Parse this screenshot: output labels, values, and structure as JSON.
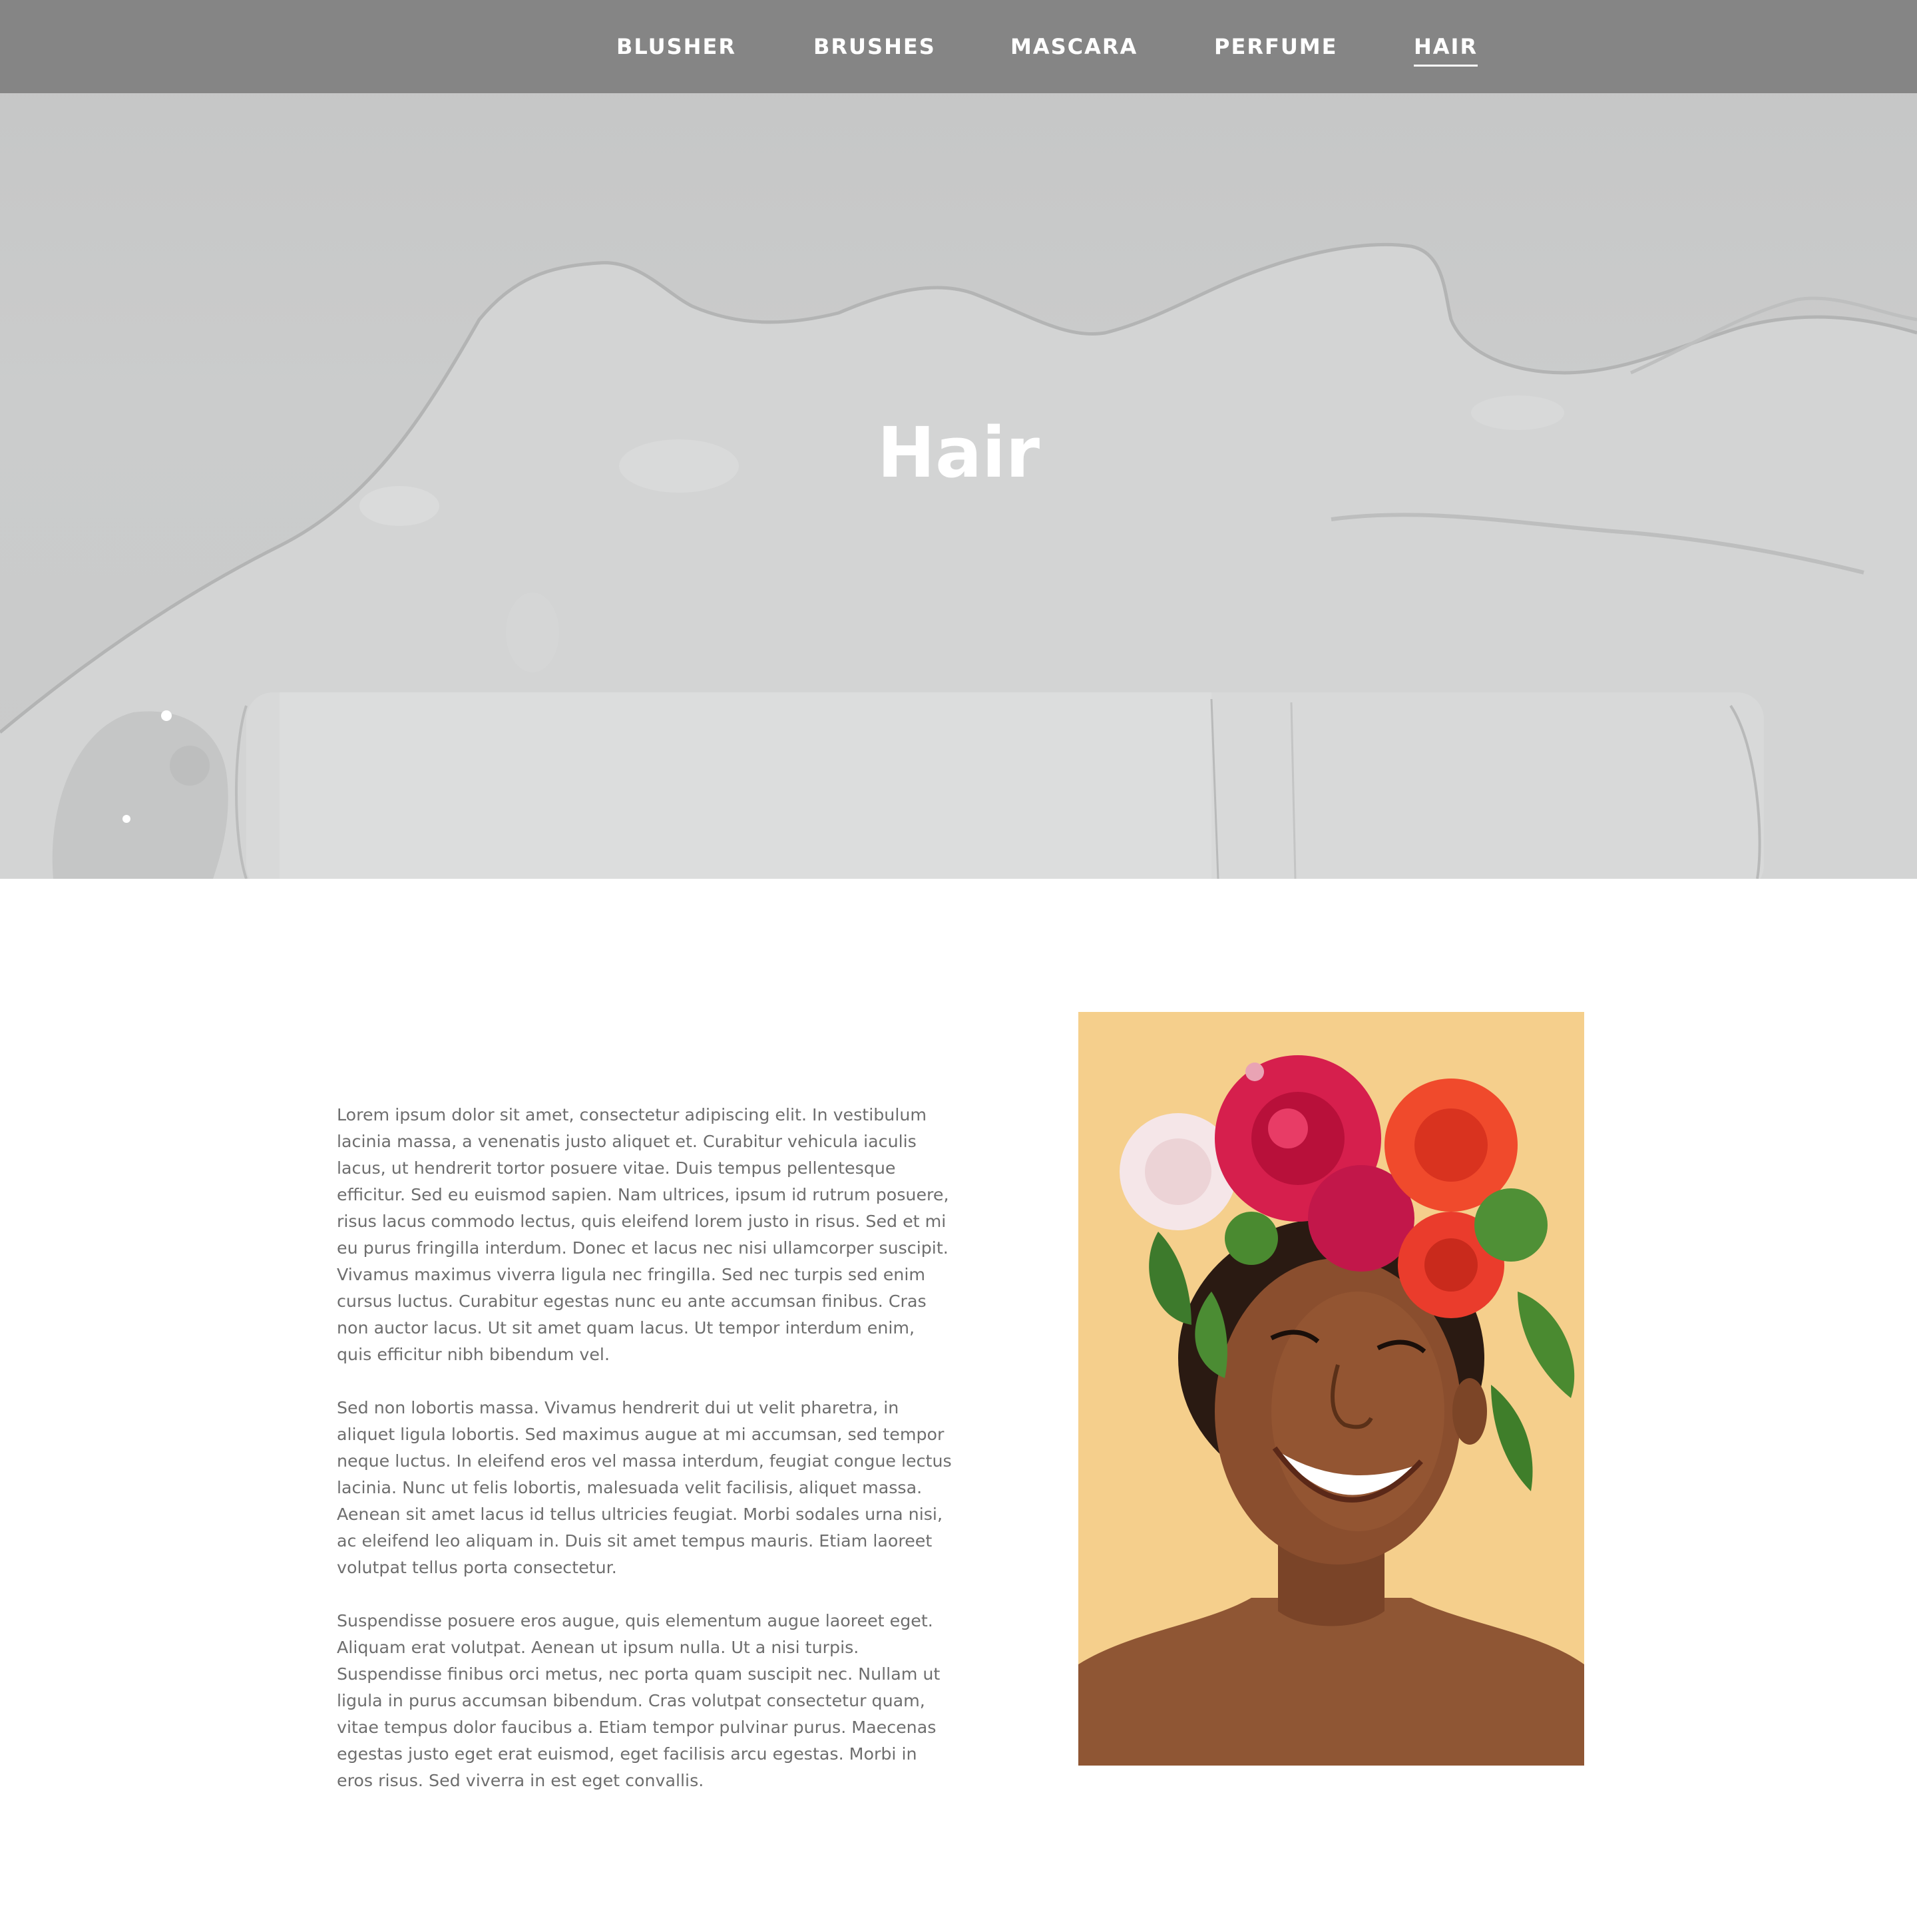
{
  "nav": {
    "items": [
      {
        "label": "BLUSHER"
      },
      {
        "label": "BRUSHES"
      },
      {
        "label": "MASCARA"
      },
      {
        "label": "PERFUME"
      },
      {
        "label": "HAIR"
      }
    ],
    "active": "HAIR"
  },
  "hero": {
    "title": "Hair",
    "image_icon": "hair-product-bottle-image"
  },
  "content": {
    "paragraphs": [
      "Lorem ipsum dolor sit amet, consectetur adipiscing elit. In vestibulum lacinia massa, a venenatis justo aliquet et. Curabitur vehicula iaculis lacus, ut hendrerit tortor posuere vitae. Duis tempus pellentesque efficitur. Sed eu euismod sapien. Nam ultrices, ipsum id rutrum posuere, risus lacus commodo lectus, quis eleifend lorem justo in risus. Sed et mi eu purus fringilla interdum. Donec et lacus nec nisi ullamcorper suscipit. Vivamus maximus viverra ligula nec fringilla. Sed nec turpis sed enim cursus luctus. Curabitur egestas nunc eu ante accumsan finibus. Cras non auctor lacus. Ut sit amet quam lacus. Ut tempor interdum enim, quis efficitur nibh bibendum vel.",
      "Sed non lobortis massa. Vivamus hendrerit dui ut velit pharetra, in aliquet ligula lobortis. Sed maximus augue at mi accumsan, sed tempor neque luctus. In eleifend eros vel massa interdum, feugiat congue lectus lacinia. Nunc ut felis lobortis, malesuada velit facilisis, aliquet massa. Aenean sit amet lacus id tellus ultricies feugiat. Morbi sodales urna nisi, ac eleifend leo aliquam in. Duis sit amet tempus mauris. Etiam laoreet volutpat tellus porta consectetur.",
      "Suspendisse posuere eros augue, quis elementum augue laoreet eget. Aliquam erat volutpat. Aenean ut ipsum nulla. Ut a nisi turpis. Suspendisse finibus orci metus, nec porta quam suscipit nec. Nullam ut ligula in purus accumsan bibendum. Cras volutpat consectetur quam, vitae tempus dolor faucibus a. Etiam tempor pulvinar purus. Maecenas egestas justo eget erat euismod, eget facilisis arcu egestas. Morbi in eros risus. Sed viverra in est eget convallis."
    ],
    "photo_icon": "woman-with-flower-crown-photo"
  },
  "colors": {
    "nav_bg": "#808080",
    "hero_bg": "#c8c9c9",
    "body_text": "#6e6e6e",
    "photo_bg": "#f5cf8c"
  }
}
